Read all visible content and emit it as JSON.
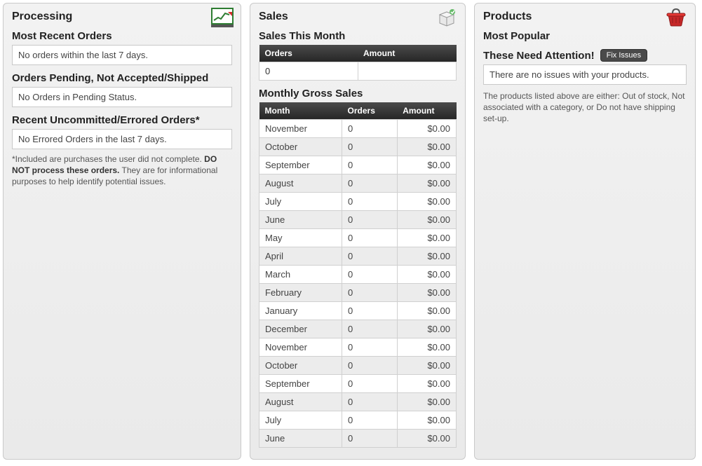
{
  "processing": {
    "title": "Processing",
    "recent_orders_title": "Most Recent Orders",
    "recent_orders_msg": "No orders within the last 7 days.",
    "pending_title": "Orders Pending, Not Accepted/Shipped",
    "pending_msg": "No Orders in Pending Status.",
    "errored_title": "Recent Uncommitted/Errored Orders*",
    "errored_msg": "No Errored Orders in the last 7 days.",
    "note_part1": "*Included are purchases the user did not complete. ",
    "note_bold": "DO NOT process these orders.",
    "note_part2": " They are for informational purposes to help identify potential issues."
  },
  "sales": {
    "title": "Sales",
    "this_month_title": "Sales This Month",
    "this_month_headers": {
      "orders": "Orders",
      "amount": "Amount"
    },
    "this_month_values": {
      "orders": "0",
      "amount": ""
    },
    "gross_title": "Monthly Gross Sales",
    "gross_headers": {
      "month": "Month",
      "orders": "Orders",
      "amount": "Amount"
    },
    "gross_rows": [
      {
        "month": "November",
        "orders": "0",
        "amount": "$0.00"
      },
      {
        "month": "October",
        "orders": "0",
        "amount": "$0.00"
      },
      {
        "month": "September",
        "orders": "0",
        "amount": "$0.00"
      },
      {
        "month": "August",
        "orders": "0",
        "amount": "$0.00"
      },
      {
        "month": "July",
        "orders": "0",
        "amount": "$0.00"
      },
      {
        "month": "June",
        "orders": "0",
        "amount": "$0.00"
      },
      {
        "month": "May",
        "orders": "0",
        "amount": "$0.00"
      },
      {
        "month": "April",
        "orders": "0",
        "amount": "$0.00"
      },
      {
        "month": "March",
        "orders": "0",
        "amount": "$0.00"
      },
      {
        "month": "February",
        "orders": "0",
        "amount": "$0.00"
      },
      {
        "month": "January",
        "orders": "0",
        "amount": "$0.00"
      },
      {
        "month": "December",
        "orders": "0",
        "amount": "$0.00"
      },
      {
        "month": "November",
        "orders": "0",
        "amount": "$0.00"
      },
      {
        "month": "October",
        "orders": "0",
        "amount": "$0.00"
      },
      {
        "month": "September",
        "orders": "0",
        "amount": "$0.00"
      },
      {
        "month": "August",
        "orders": "0",
        "amount": "$0.00"
      },
      {
        "month": "July",
        "orders": "0",
        "amount": "$0.00"
      },
      {
        "month": "June",
        "orders": "0",
        "amount": "$0.00"
      }
    ]
  },
  "products": {
    "title": "Products",
    "popular_title": "Most Popular",
    "attention_title": "These Need Attention!",
    "fix_btn": "Fix Issues",
    "no_issues_msg": "There are no issues with your products.",
    "desc": "The products listed above are either: Out of stock, Not associated with a category, or Do not have shipping set-up."
  }
}
